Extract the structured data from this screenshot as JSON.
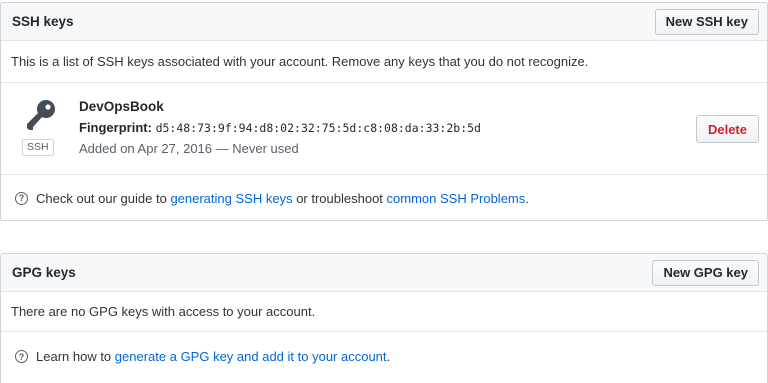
{
  "ssh": {
    "title": "SSH keys",
    "new_button": "New SSH key",
    "intro": "This is a list of SSH keys associated with your account. Remove any keys that you do not recognize.",
    "keys": [
      {
        "title": "DevOpsBook",
        "badge": "SSH",
        "fingerprint_label": "Fingerprint:",
        "fingerprint": "d5:48:73:9f:94:d8:02:32:75:5d:c8:08:da:33:2b:5d",
        "added": "Added on Apr 27, 2016 — Never used",
        "delete_label": "Delete"
      }
    ],
    "help": {
      "icon": "?",
      "prefix": "Check out our guide to ",
      "link1": "generating SSH keys",
      "middle": " or troubleshoot ",
      "link2": "common SSH Problems",
      "suffix": "."
    }
  },
  "gpg": {
    "title": "GPG keys",
    "new_button": "New GPG key",
    "empty_text": "There are no GPG keys with access to your account.",
    "help": {
      "icon": "?",
      "prefix": "Learn how to ",
      "link": "generate a GPG key and add it to your account",
      "suffix": "."
    }
  },
  "colors": {
    "link": "#0366d6",
    "danger": "#cb2431",
    "header_bg": "#f6f8fa",
    "border": "#d1d5da"
  },
  "icons": {
    "key": "key-icon",
    "help": "question-circle-icon"
  }
}
